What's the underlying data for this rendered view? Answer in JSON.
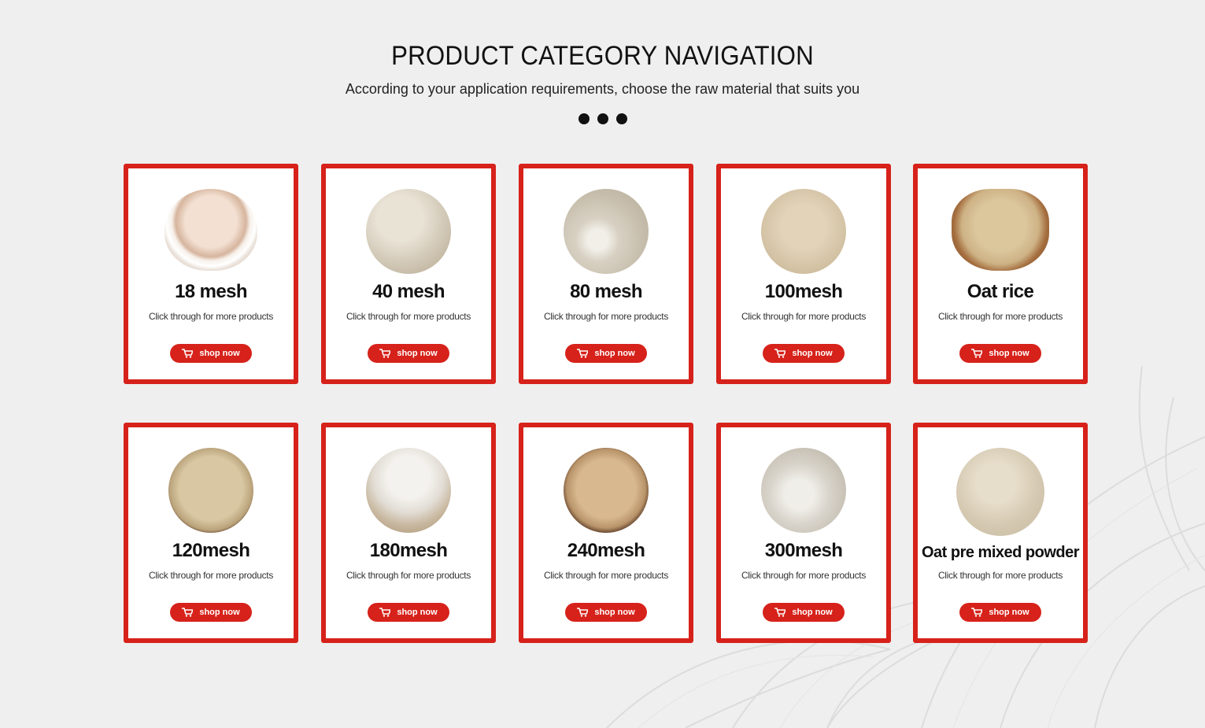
{
  "header": {
    "title": "PRODUCT CATEGORY NAVIGATION",
    "subtitle": "According to your application requirements, choose the raw material that suits you"
  },
  "colors": {
    "accent": "#d6221a",
    "background": "#efefef",
    "card": "#ffffff"
  },
  "products": [
    {
      "name": "18 mesh",
      "desc": "Click through for more products",
      "button": "shop now",
      "icon": "cart-icon"
    },
    {
      "name": "40 mesh",
      "desc": "Click through for more products",
      "button": "shop now",
      "icon": "cart-icon"
    },
    {
      "name": "80 mesh",
      "desc": "Click through for more products",
      "button": "shop now",
      "icon": "cart-icon"
    },
    {
      "name": "100mesh",
      "desc": "Click through for more products",
      "button": "shop now",
      "icon": "cart-icon"
    },
    {
      "name": "Oat rice",
      "desc": "Click through for more products",
      "button": "shop now",
      "icon": "cart-icon"
    },
    {
      "name": "120mesh",
      "desc": "Click through for more products",
      "button": "shop now",
      "icon": "cart-icon"
    },
    {
      "name": "180mesh",
      "desc": "Click through for more products",
      "button": "shop now",
      "icon": "cart-icon"
    },
    {
      "name": "240mesh",
      "desc": "Click through for more products",
      "button": "shop now",
      "icon": "cart-icon"
    },
    {
      "name": "300mesh",
      "desc": "Click through for more products",
      "button": "shop now",
      "icon": "cart-icon"
    },
    {
      "name": "Oat pre mixed powder",
      "desc": "Click through for more products",
      "button": "shop now",
      "icon": "cart-icon"
    }
  ]
}
